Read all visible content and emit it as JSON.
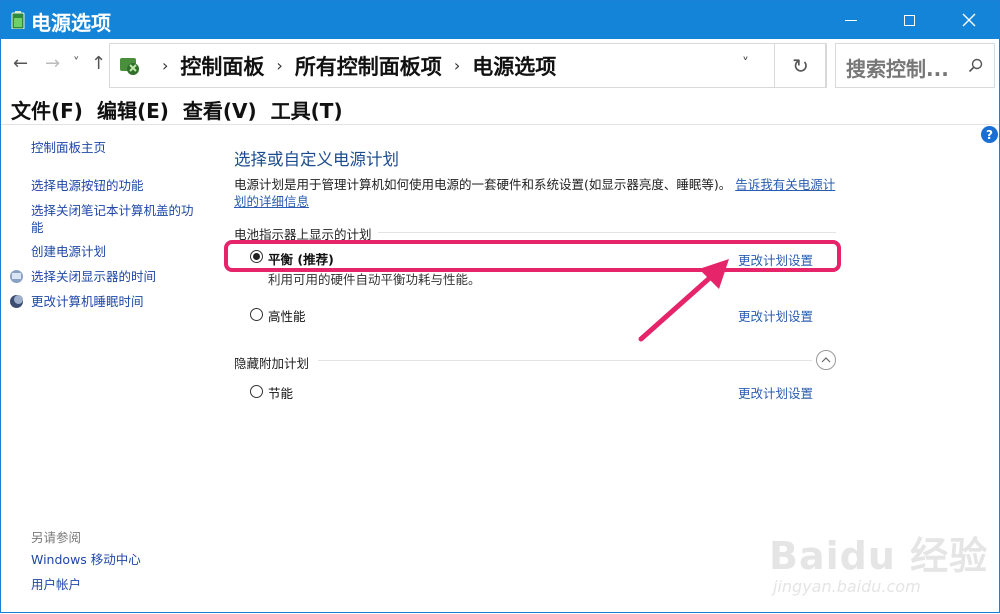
{
  "window": {
    "title": "电源选项",
    "buttons": {
      "minimize": "minimize-icon",
      "maximize": "maximize-icon",
      "close": "×"
    }
  },
  "nav": {
    "back": "←",
    "forward": "→",
    "recent": "˅",
    "up": "↑",
    "breadcrumbs": [
      "控制面板",
      "所有控制面板项",
      "电源选项"
    ],
    "dropdown": "˅",
    "refresh": "↻",
    "search_placeholder": "搜索控制..."
  },
  "menu": [
    "文件(F)",
    "编辑(E)",
    "查看(V)",
    "工具(T)"
  ],
  "left_pane": {
    "home": "控制面板主页",
    "links": [
      "选择电源按钮的功能",
      "选择关闭笔记本计算机盖的功",
      "能",
      "创建电源计划",
      "选择关闭显示器的时间",
      "更改计算机睡眠时间"
    ],
    "see_also": "另请参阅",
    "see_also_links": [
      "Windows 移动中心",
      "用户帐户"
    ]
  },
  "main": {
    "help": "?",
    "heading": "选择或自定义电源计划",
    "description": "电源计划是用于管理计算机如何使用电源的一套硬件和系统设置(如显示器亮度、睡眠等)。",
    "description_link": "告诉我有关电源计划的详细信息",
    "battery_group": "电池指示器上显示的计划",
    "plans": [
      {
        "name": "平衡 (推荐)",
        "selected": true,
        "desc": "利用可用的硬件自动平衡功耗与性能。",
        "change": "更改计划设置"
      },
      {
        "name": "高性能",
        "selected": false,
        "change": "更改计划设置"
      }
    ],
    "hidden_group": "隐藏附加计划",
    "hidden_plans": [
      {
        "name": "节能",
        "selected": false,
        "change": "更改计划设置"
      }
    ]
  },
  "watermark": {
    "brand": "Baidu 经验",
    "url": "jingyan.baidu.com"
  },
  "colors": {
    "titlebar": "#1384d8",
    "link": "#2a5db0",
    "highlight": "#e5246a"
  }
}
